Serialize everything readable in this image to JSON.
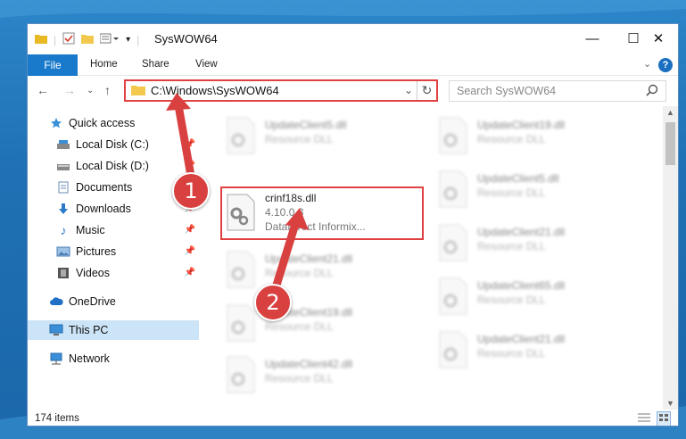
{
  "window": {
    "title": "SysWOW64"
  },
  "window_controls": {
    "minimize": "—",
    "maximize": "☐",
    "close": "✕"
  },
  "ribbon": {
    "file_tab": "File",
    "tabs": [
      "Home",
      "Share",
      "View"
    ]
  },
  "address_bar": {
    "path": "C:\\Windows\\SysWOW64"
  },
  "search": {
    "placeholder": "Search SysWOW64"
  },
  "nav_pane": {
    "items": [
      {
        "label": "Quick access",
        "icon": "star-icon",
        "pinned": false
      },
      {
        "label": "Local Disk (C:)",
        "icon": "drive-icon",
        "pinned": true
      },
      {
        "label": "Local Disk (D:)",
        "icon": "drive-icon",
        "pinned": true
      },
      {
        "label": "Documents",
        "icon": "documents-icon",
        "pinned": true
      },
      {
        "label": "Downloads",
        "icon": "download-icon",
        "pinned": true
      },
      {
        "label": "Music",
        "icon": "music-icon",
        "pinned": true
      },
      {
        "label": "Pictures",
        "icon": "pictures-icon",
        "pinned": true
      },
      {
        "label": "Videos",
        "icon": "videos-icon",
        "pinned": true
      },
      {
        "label": "OneDrive",
        "icon": "cloud-icon",
        "pinned": false
      },
      {
        "label": "This PC",
        "icon": "computer-icon",
        "pinned": false,
        "selected": true
      },
      {
        "label": "Network",
        "icon": "network-icon",
        "pinned": false
      }
    ]
  },
  "files": {
    "highlighted": {
      "name": "crinf18s.dll",
      "version": "4.10.0.3",
      "description": "DataDirect Informix..."
    },
    "left_column": [
      {
        "name": "UpdateClient5.dll",
        "type": "Resource DLL"
      },
      {
        "name": "UpdateClient21.dll",
        "type": "Resource DLL"
      },
      {
        "name": "UpdateClient19.dll",
        "type": "Resource DLL"
      },
      {
        "name": "UpdateClient42.dll",
        "type": "Resource DLL"
      }
    ],
    "right_column": [
      {
        "name": "UpdateClient19.dll",
        "type": "Resource DLL"
      },
      {
        "name": "UpdateClient5.dll",
        "type": "Resource DLL"
      },
      {
        "name": "UpdateClient21.dll",
        "type": "Resource DLL"
      },
      {
        "name": "UpdateClient65.dll",
        "type": "Resource DLL"
      },
      {
        "name": "UpdateClient21.dll",
        "type": "Resource DLL"
      }
    ]
  },
  "status_bar": {
    "item_count": "174 items"
  },
  "callouts": [
    "1",
    "2"
  ],
  "colors": {
    "highlight_red": "#e04040",
    "callout_red": "#d94040",
    "file_tab_blue": "#1979ca",
    "selection_blue": "#cce4f7"
  }
}
